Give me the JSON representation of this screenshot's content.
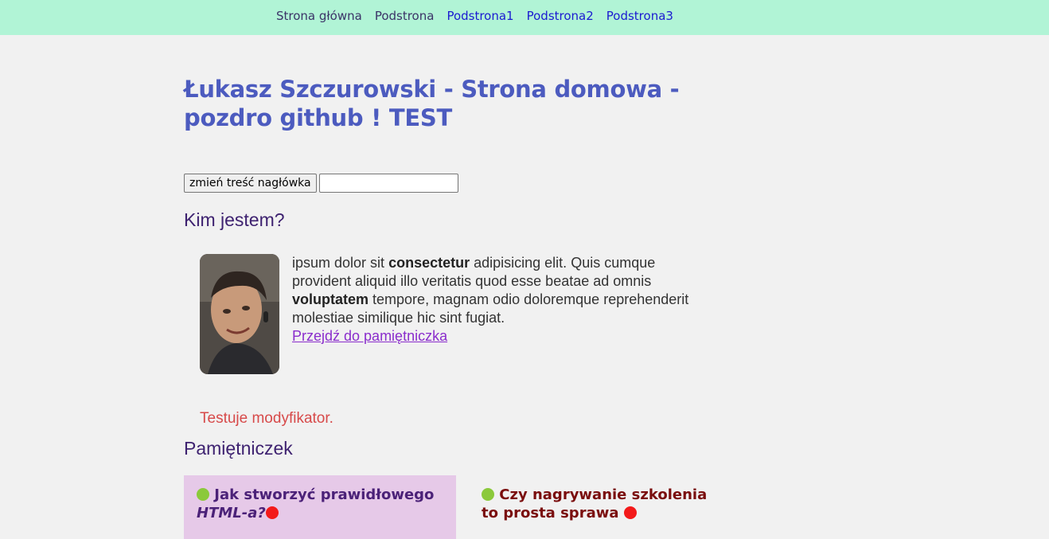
{
  "nav": {
    "items": [
      {
        "label": "Strona główna"
      },
      {
        "label": "Podstrona"
      },
      {
        "label": "Podstrona1"
      },
      {
        "label": "Podstrona2"
      },
      {
        "label": "Podstrona3"
      }
    ]
  },
  "header": {
    "title": "Łukasz Szczurowski - Strona domowa - pozdro github ! TEST"
  },
  "controls": {
    "button_label": "zmień treść nagłówka",
    "input_value": ""
  },
  "about": {
    "heading": "Kim jestem?",
    "p1": "ipsum dolor sit",
    "b1": "consectetur",
    "p2": "adipisicing elit. Quis cumque provident aliquid illo veritatis quod esse beatae ad omnis",
    "b2": "voluptatem",
    "p3": "tempore, magnam odio doloremque reprehenderit molestiae similique hic sint fugiat.",
    "link": "Przejdź do pamiętniczka"
  },
  "modifier_text": "Testuje modyfikator.",
  "diary": {
    "heading": "Pamiętniczek",
    "cards": [
      {
        "title_a": "Jak stworzyć prawidłowego",
        "title_b": "HTML-a?"
      },
      {
        "title": "Czy nagrywanie szkolenia to prosta sprawa"
      }
    ]
  },
  "colors": {
    "nav_bg": "#b1f4d6",
    "title": "#4c5bbf",
    "heading": "#3e2270",
    "modifier": "#d74a4a",
    "card_bg": "#e6c9e8",
    "dot_green": "#8bc93b",
    "dot_red": "#f31a1a"
  }
}
